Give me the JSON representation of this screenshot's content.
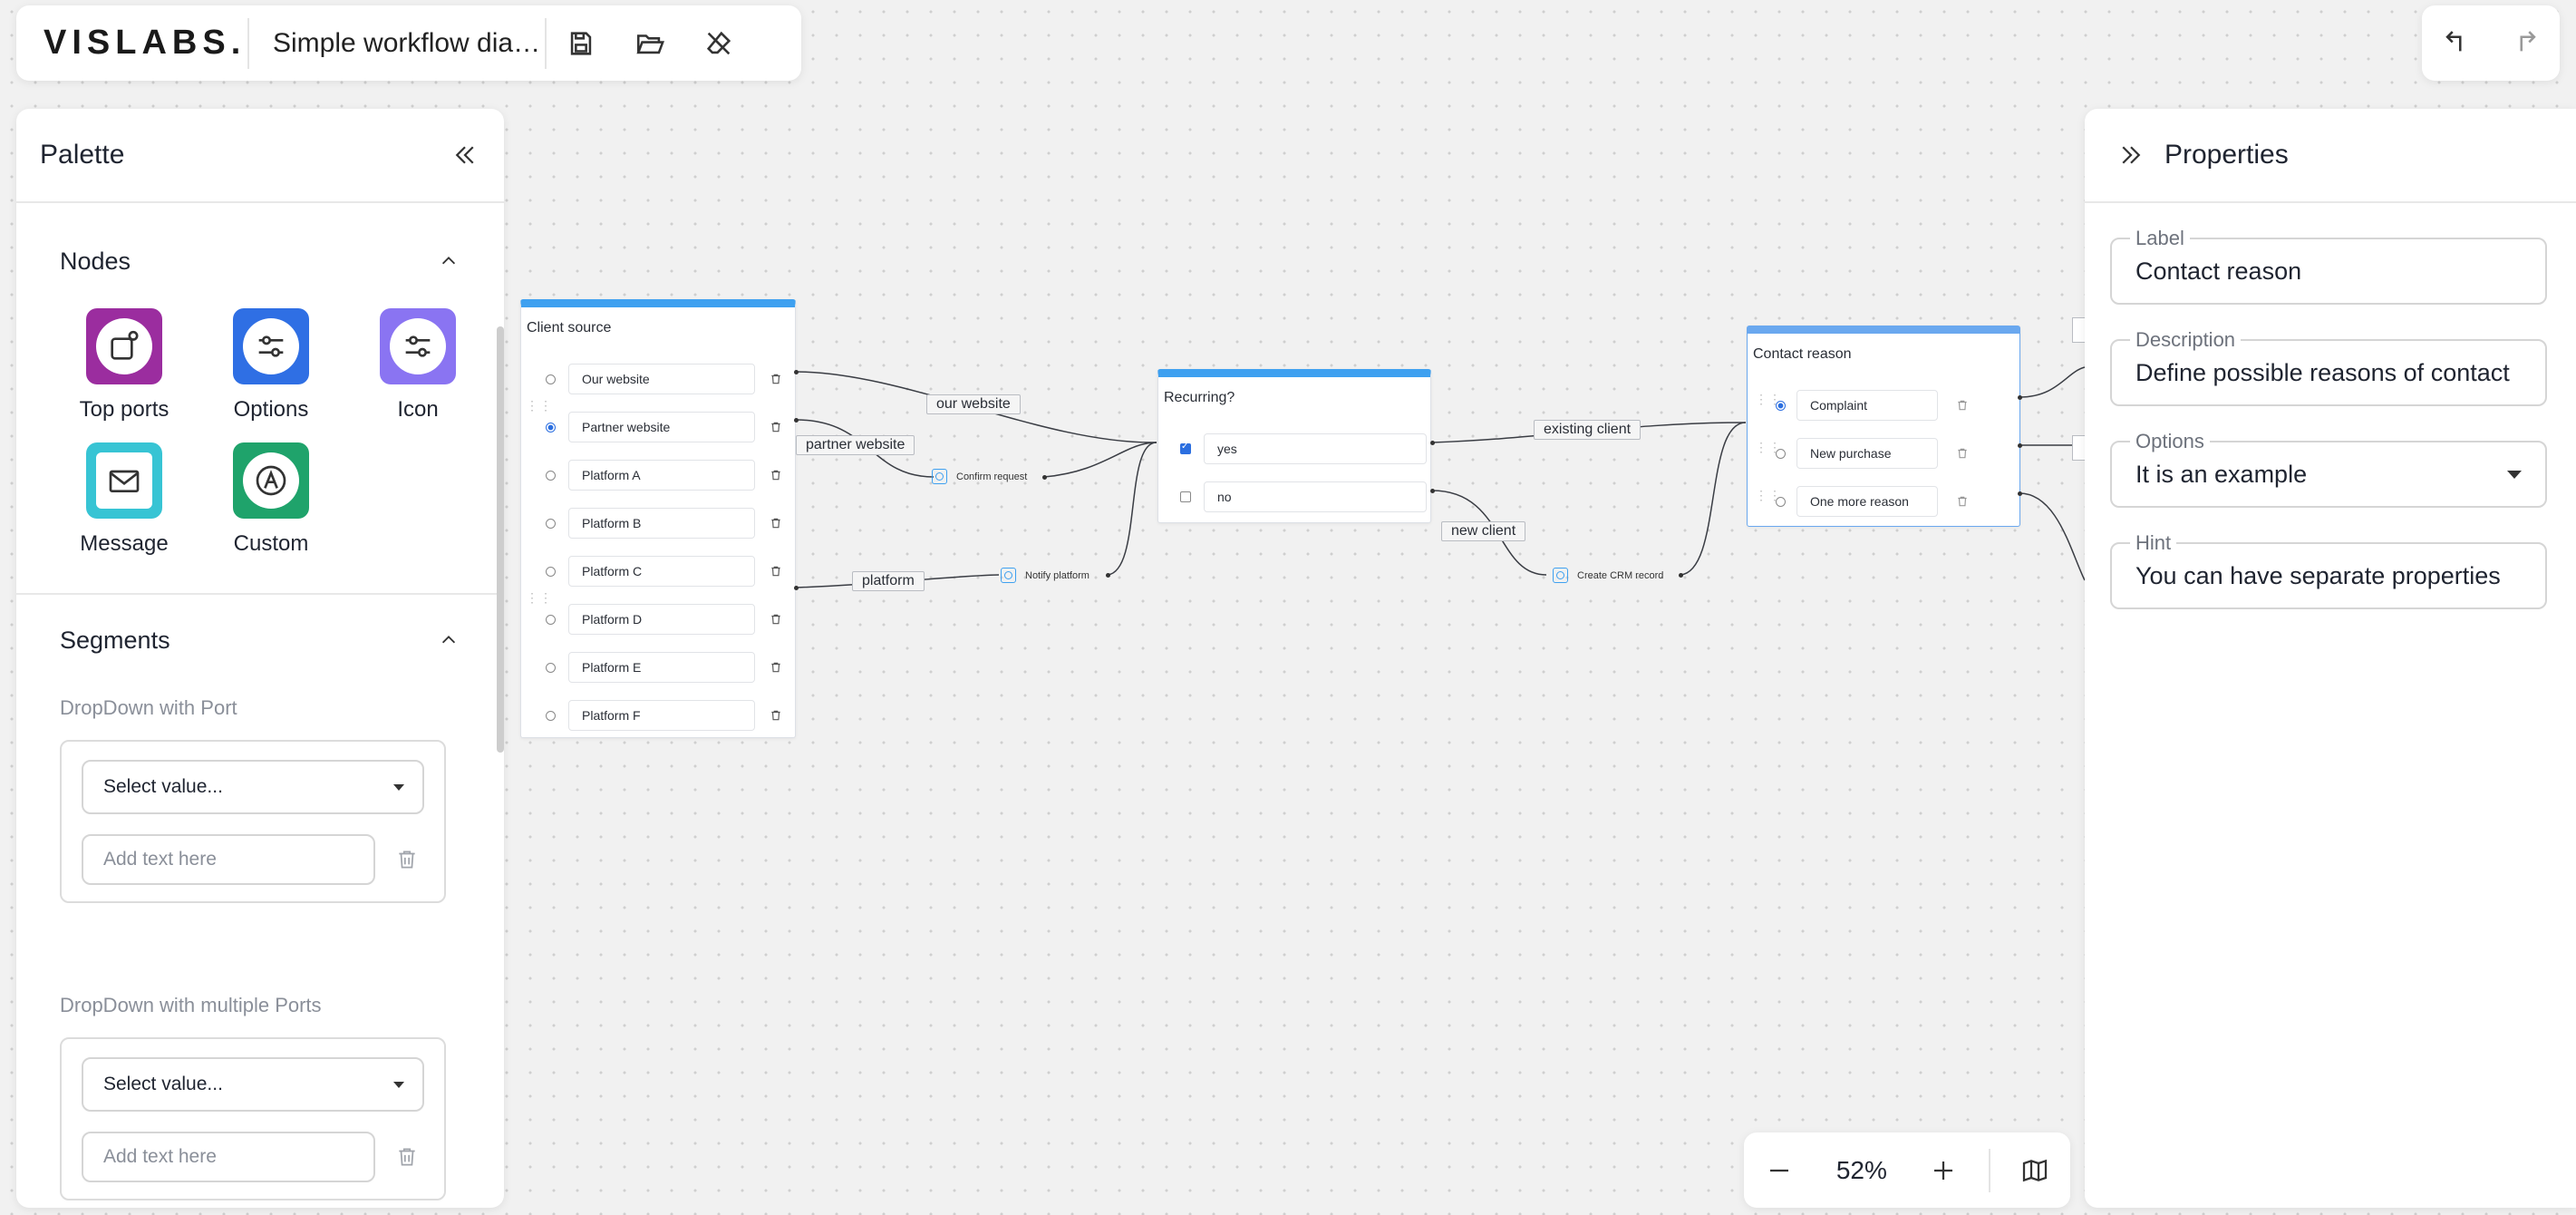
{
  "app": {
    "logo": "VISLABS.",
    "document_title": "Simple workflow diagram",
    "toolbar": {
      "save_icon": "save-icon",
      "open_icon": "folder-open-icon",
      "clear_icon": "eraser-icon"
    },
    "history": {
      "undo_icon": "undo-icon",
      "redo_icon": "redo-icon"
    }
  },
  "palette": {
    "title": "Palette",
    "nodes_section": {
      "title": "Nodes",
      "items": [
        {
          "label": "Top ports",
          "icon": "top-ports-icon",
          "color": "#9b2d9f"
        },
        {
          "label": "Options",
          "icon": "options-icon",
          "color": "#2f6fe4"
        },
        {
          "label": "Icon",
          "icon": "icon-node-icon",
          "color": "#8a74f2"
        },
        {
          "label": "Message",
          "icon": "mail-icon",
          "color": "#37c4d4"
        },
        {
          "label": "Custom",
          "icon": "custom-node-icon",
          "color": "#1fa36b"
        }
      ]
    },
    "segments_section": {
      "title": "Segments",
      "items": [
        {
          "label": "DropDown with Port",
          "select_placeholder": "Select value...",
          "text_placeholder": "Add text here"
        },
        {
          "label": "DropDown with multiple Ports",
          "select_placeholder": "Select value...",
          "text_placeholder": "Add text here"
        }
      ]
    }
  },
  "properties": {
    "title": "Properties",
    "fields": [
      {
        "label": "Label",
        "value": "Contact reason"
      },
      {
        "label": "Description",
        "value": "Define possible reasons of contact"
      },
      {
        "label": "Options",
        "value": "It is an example"
      },
      {
        "label": "Hint",
        "value": "You can have separate properties"
      }
    ]
  },
  "zoom": {
    "value": "52%"
  },
  "canvas": {
    "client_source": {
      "title": "Client source",
      "options": [
        "Our website",
        "Partner website",
        "Platform A",
        "Platform B",
        "Platform C",
        "Platform D",
        "Platform E",
        "Platform F"
      ],
      "selected_index": 1
    },
    "recurring": {
      "title": "Recurring?",
      "options": [
        {
          "label": "yes",
          "checked": true
        },
        {
          "label": "no",
          "checked": false
        }
      ]
    },
    "contact_reason": {
      "title": "Contact reason",
      "options": [
        "Complaint",
        "New purchase",
        "One more reason"
      ],
      "selected_index": 0
    },
    "small_nodes": [
      "Confirm request",
      "Notify platform",
      "Create CRM record"
    ],
    "edge_labels": [
      "our website",
      "partner website",
      "platform",
      "existing client",
      "new client"
    ],
    "accent_color": "#3ea0f0"
  }
}
